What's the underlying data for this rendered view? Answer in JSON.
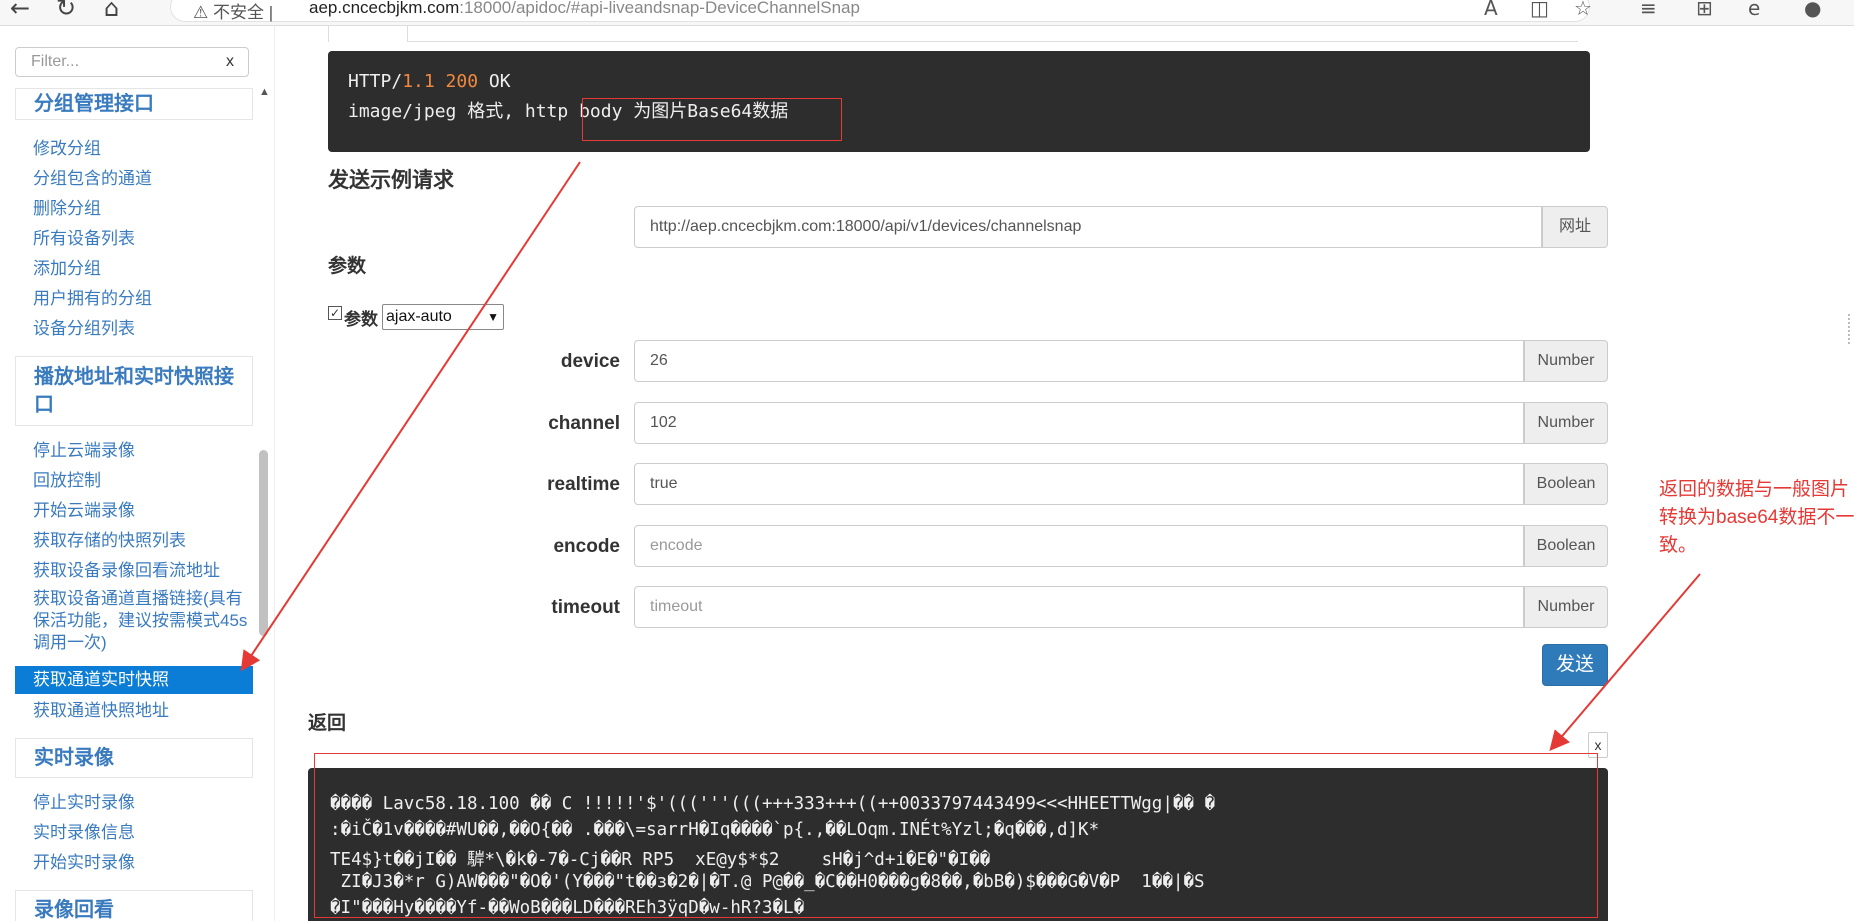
{
  "browser": {
    "back_icon": "back-arrow-icon",
    "refresh_icon": "refresh-icon",
    "home_icon": "home-icon",
    "security_label": "不安全",
    "url_host": "aep.cncecbjkm.com",
    "url_rest": ":18000/apidoc/#api-liveandsnap-DeviceChannelSnap"
  },
  "sidebar": {
    "filter_placeholder": "Filter...",
    "filter_clear": "x",
    "groups": [
      {
        "title": "分组管理接口",
        "items": [
          "修改分组",
          "分组包含的通道",
          "删除分组",
          "所有设备列表",
          "添加分组",
          "用户拥有的分组",
          "设备分组列表"
        ]
      },
      {
        "title": "播放地址和实时快照接口",
        "items": [
          "停止云端录像",
          "回放控制",
          "开始云端录像",
          "获取存储的快照列表",
          "获取设备录像回看流地址",
          "获取设备通道直播链接(具有保活功能，建议按需模式45s调用一次)",
          "获取通道实时快照",
          "获取通道快照地址"
        ]
      },
      {
        "title": "实时录像",
        "items": [
          "停止实时录像",
          "实时录像信息",
          "开始实时录像"
        ]
      },
      {
        "title": "录像回看",
        "items": []
      }
    ],
    "active_item": "获取通道实时快照"
  },
  "response_example": {
    "line1_proto": "HTTP/",
    "line1_ver": "1.1",
    "line1_code": "200",
    "line1_text": "OK",
    "line2": "image/jpeg 格式, http body 为图片Base64数据"
  },
  "send_section": {
    "title": "发送示例请求",
    "url_value": "http://aep.cncecbjkm.com:18000/api/v1/devices/channelsnap",
    "url_addon": "网址",
    "params_title": "参数",
    "params_checkbox_label": "参数",
    "mode_select_value": "ajax-auto",
    "params": [
      {
        "name": "device",
        "value": "26",
        "placeholder": "",
        "type": "Number"
      },
      {
        "name": "channel",
        "value": "102",
        "placeholder": "",
        "type": "Number"
      },
      {
        "name": "realtime",
        "value": "true",
        "placeholder": "",
        "type": "Boolean"
      },
      {
        "name": "encode",
        "value": "",
        "placeholder": "encode",
        "type": "Boolean"
      },
      {
        "name": "timeout",
        "value": "",
        "placeholder": "timeout",
        "type": "Number"
      }
    ],
    "send_label": "发送"
  },
  "return_section": {
    "title": "返回",
    "close_label": "x",
    "output_lines": [
      "���� \u0010Lavc58.18.100 �� C \b\u0010\u0010\u0013\u0010\u0013!!!!!'$'((('''(((+++333+++((++0033797443499<<<HHEETTWgg|�� �  \b\b\b\b\b",
      ":�iČ�1v����#WU��,��O{�� \b.���\\=sa\u0001rr\bH�Iq����`p{.,��L\u0001O\u0007\bq\u0002m\b.IN\u0001\u0001Ét%Yz\u0001\u0001l\b\b\b\b\b\b\b\b\b;�q���,\bd\b]K*",
      "TE4$}t��j\u0001I�� 䮗*\\�k�-7�-Cj��R RP\u0001\u00015  \bxE@y\u0001$\u0002*\u0001\u0001$\u00012\u0001\u0001    sH�j^d+i�E\u0001�\"�I��",
      " ZI�J3\u0001�*r \bG\u0001)AW\u0001���\"\u0001�\u0002O�'(Y\u0001���\"t��з�2�|�T.@ P@��_�C��H0���g�8��,�\u0001bB�)$���G�V�\u0001P  1��|�S",
      "�I\"\u0001���H\u0001y����Yf-��\u0001WoB���\u0001L\u0001D���\u0001REh3ÿqD�\u0001w-hR?\u00013�L�"
    ],
    "annotation": "返回的数据与一般图片转换为base64数据不一致。"
  },
  "colors": {
    "accent_blue": "#3a7bbf",
    "active_bg": "#0b7dd6",
    "send_btn": "#2f7ab8",
    "code_bg": "#2d2d2d",
    "annotation_red": "#e53935"
  }
}
